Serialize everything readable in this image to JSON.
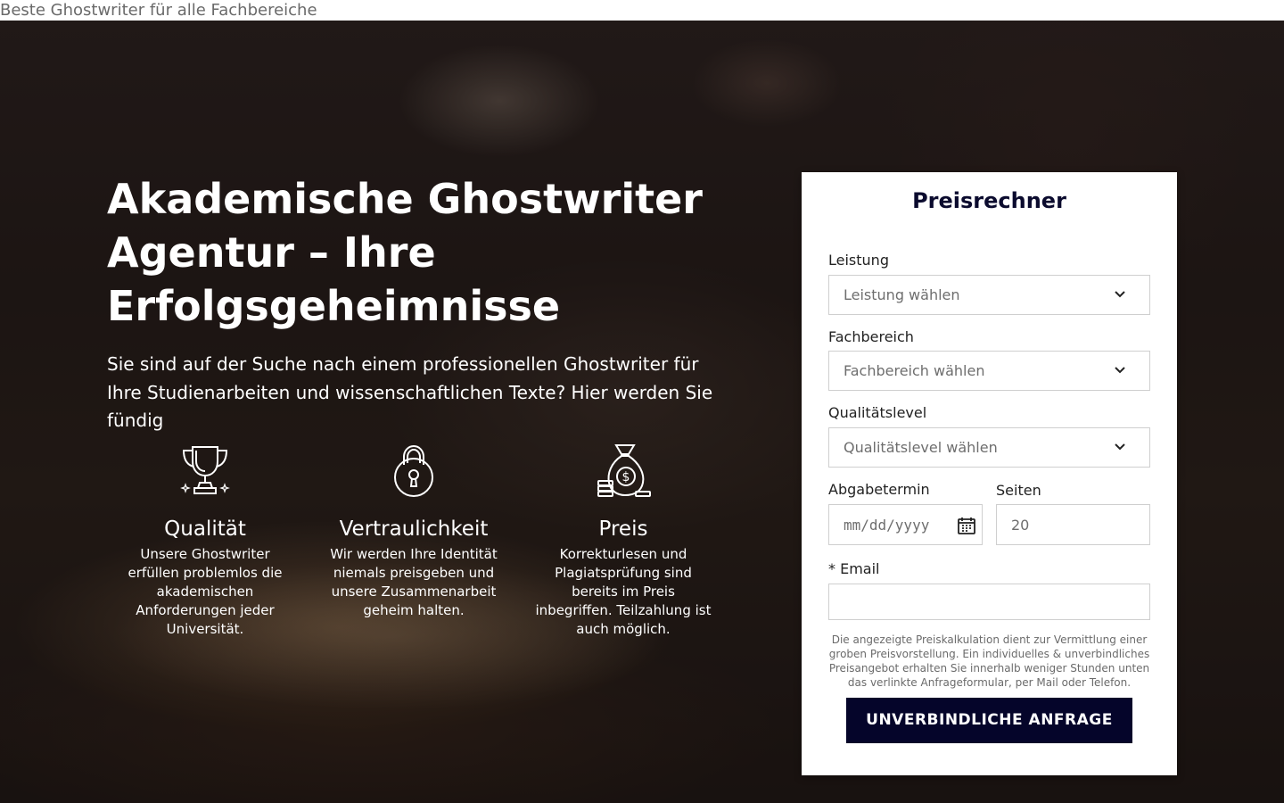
{
  "topbar": {
    "text": "Beste Ghostwriter für alle Fachbereiche"
  },
  "hero": {
    "headline": "Akademische Ghostwriter Agentur – Ihre Erfolgsgeheimnisse",
    "intro": "Sie sind auf der Suche nach einem professionellen Ghostwriter für Ihre Studienarbeiten und wissenschaftlichen Texte? Hier werden Sie fündig"
  },
  "features": [
    {
      "icon": "trophy-icon",
      "title": "Qualität",
      "text": "Unsere Ghostwriter erfüllen problemlos die akademischen Anforderungen jeder Universität."
    },
    {
      "icon": "padlock-icon",
      "title": "Vertraulichkeit",
      "text": "Wir werden Ihre Identität niemals preisgeben und unsere Zusammenarbeit geheim halten."
    },
    {
      "icon": "money-bag-icon",
      "title": "Preis",
      "text": "Korrekturlesen und Plagiatsprüfung sind bereits im Preis inbegriffen. Teilzahlung ist auch möglich."
    }
  ],
  "calculator": {
    "title": "Preisrechner",
    "service": {
      "label": "Leistung",
      "placeholder": "Leistung wählen"
    },
    "field": {
      "label": "Fachbereich",
      "placeholder": "Fachbereich wählen"
    },
    "quality": {
      "label": "Qualitätslevel",
      "placeholder": "Qualitätslevel wählen"
    },
    "deadline": {
      "label": "Abgabetermin",
      "placeholder": "mm/dd/yyyy"
    },
    "pages": {
      "label": "Seiten",
      "placeholder": "20"
    },
    "email": {
      "label": "* Email",
      "value": ""
    },
    "note": "Die angezeigte Preiskalkulation dient zur Vermittlung einer groben Preisvorstellung. Ein individuelles & unverbindliches Preisangebot erhalten Sie innerhalb weniger Stunden unten das verlinkte Anfrageformular, per Mail oder Telefon.",
    "submit": "UNVERBINDLICHE ANFRAGE"
  },
  "colors": {
    "button": "#05052a",
    "title": "#0b0b2e"
  }
}
